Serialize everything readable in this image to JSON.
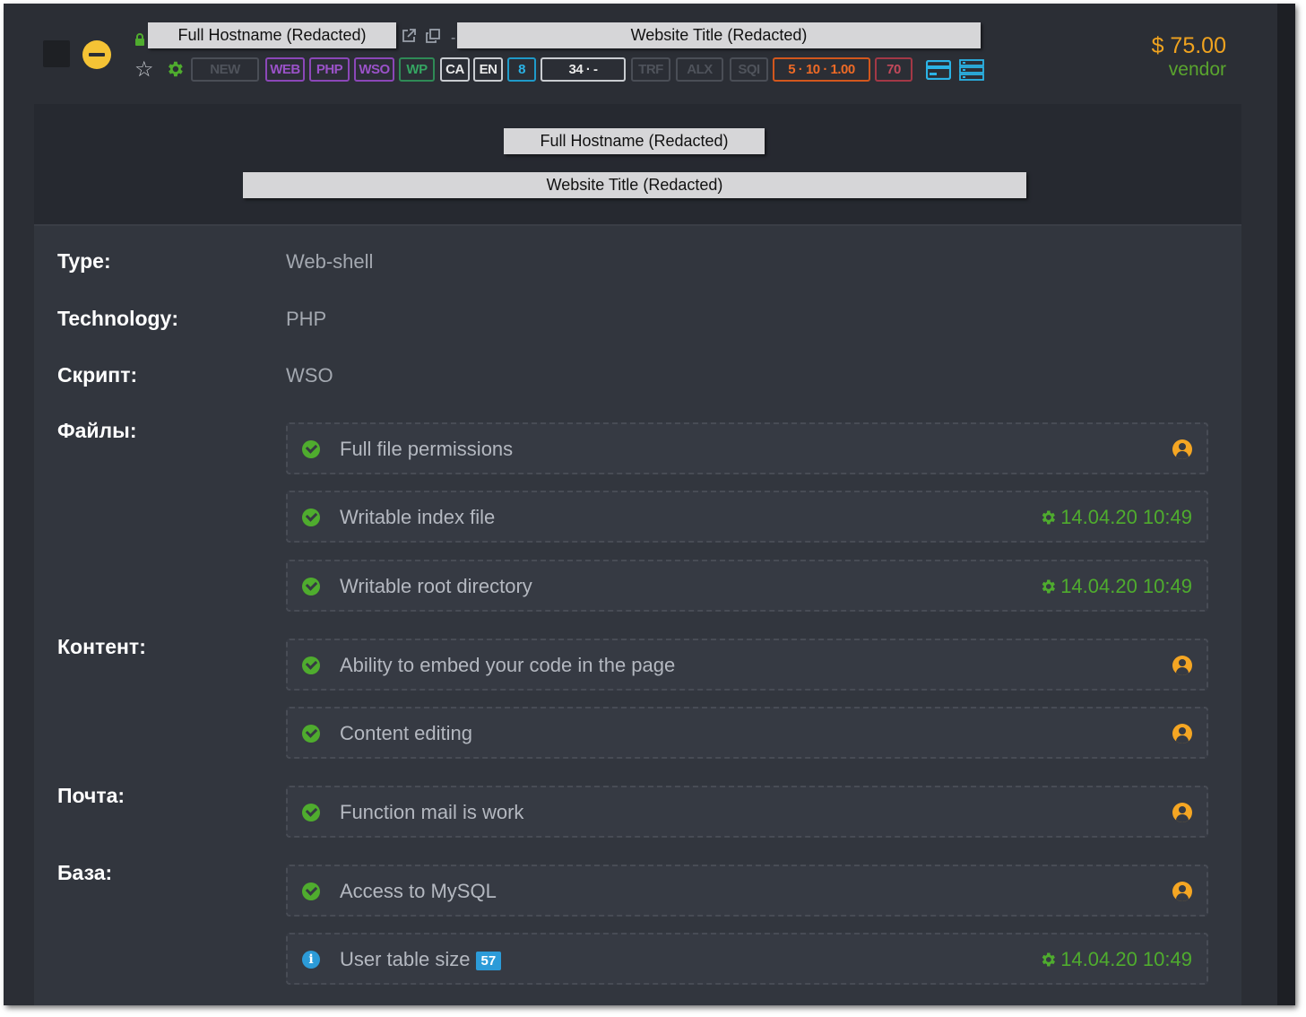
{
  "header": {
    "hostname": "Full Hostname (Redacted)",
    "site_title": "Website Title (Redacted)",
    "separator": "-",
    "badges": {
      "new": "NEW",
      "web": "WEB",
      "php": "PHP",
      "wso": "WSO",
      "wp": "WP",
      "ca": "CA",
      "en": "EN",
      "count": "8",
      "rank": "34 · -",
      "trf": "TRF",
      "alx": "ALX",
      "sqi": "SQI",
      "stats": "5 · 10 · 1.00",
      "score": "70"
    },
    "price": "$ 75.00",
    "seller": "vendor",
    "colors": {
      "price": "#f0a31f",
      "seller": "#5aa52e",
      "status_minus": "#f5c335"
    }
  },
  "panel": {
    "hostname": "Full Hostname (Redacted)",
    "site_title": "Website Title (Redacted)"
  },
  "details": {
    "type_label": "Type:",
    "type_value": "Web-shell",
    "tech_label": "Technology:",
    "tech_value": "PHP",
    "script_label": "Скрипт:",
    "script_value": "WSO",
    "files_label": "Файлы:",
    "content_label": "Контент:",
    "mail_label": "Почта:",
    "db_label": "База:"
  },
  "features": {
    "files": [
      {
        "text": "Full file permissions",
        "icon": "user-icon"
      },
      {
        "text": "Writable index file",
        "date": "14.04.20 10:49",
        "icon": "gear-icon"
      },
      {
        "text": "Writable root directory",
        "date": "14.04.20 10:49",
        "icon": "gear-icon"
      }
    ],
    "content": [
      {
        "text": "Ability to embed your code in the page",
        "icon": "user-icon"
      },
      {
        "text": "Content editing",
        "icon": "user-icon"
      }
    ],
    "mail": [
      {
        "text": "Function mail is work",
        "icon": "user-icon"
      }
    ],
    "db": [
      {
        "text": "Access to MySQL",
        "icon": "user-icon"
      },
      {
        "text": "User table size",
        "count": "57",
        "date": "14.04.20 10:49",
        "icon": "gear-icon"
      }
    ]
  }
}
